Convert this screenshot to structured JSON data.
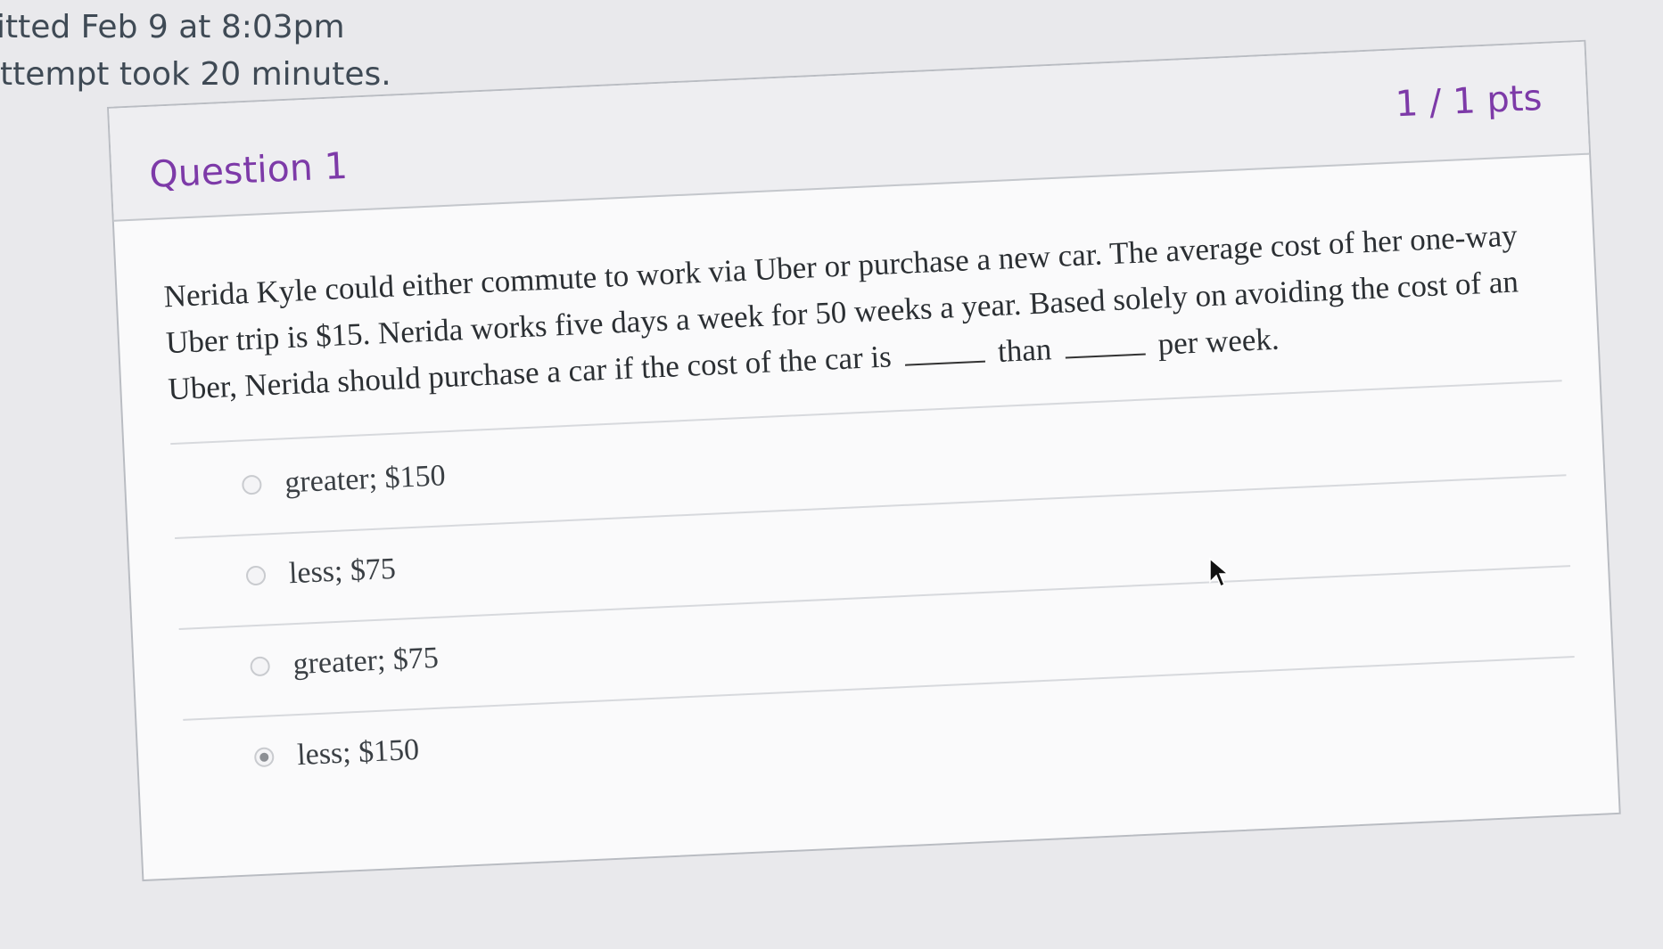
{
  "header": {
    "submitted_line": "itted Feb 9 at 8:03pm",
    "attempt_line": "ttempt took 20 minutes."
  },
  "question": {
    "title": "Question 1",
    "points": "1 / 1 pts",
    "text_part1": "Nerida Kyle could either commute to work via Uber or purchase a new car. The average cost of her one-way Uber trip is $15. Nerida works five days a week for 50 weeks a year. Based solely on avoiding the cost of an Uber, Nerida should purchase a car if the cost of the car is",
    "text_part2": "than",
    "text_part3": "per week.",
    "answers": [
      {
        "label": "greater; $150",
        "selected": false
      },
      {
        "label": "less; $75",
        "selected": false
      },
      {
        "label": "greater; $75",
        "selected": false
      },
      {
        "label": "less; $150",
        "selected": true
      }
    ]
  },
  "colors": {
    "accent": "#7d3aa8",
    "background": "#e9e9ec"
  },
  "icons": {
    "cursor": "mouse-pointer-icon"
  }
}
